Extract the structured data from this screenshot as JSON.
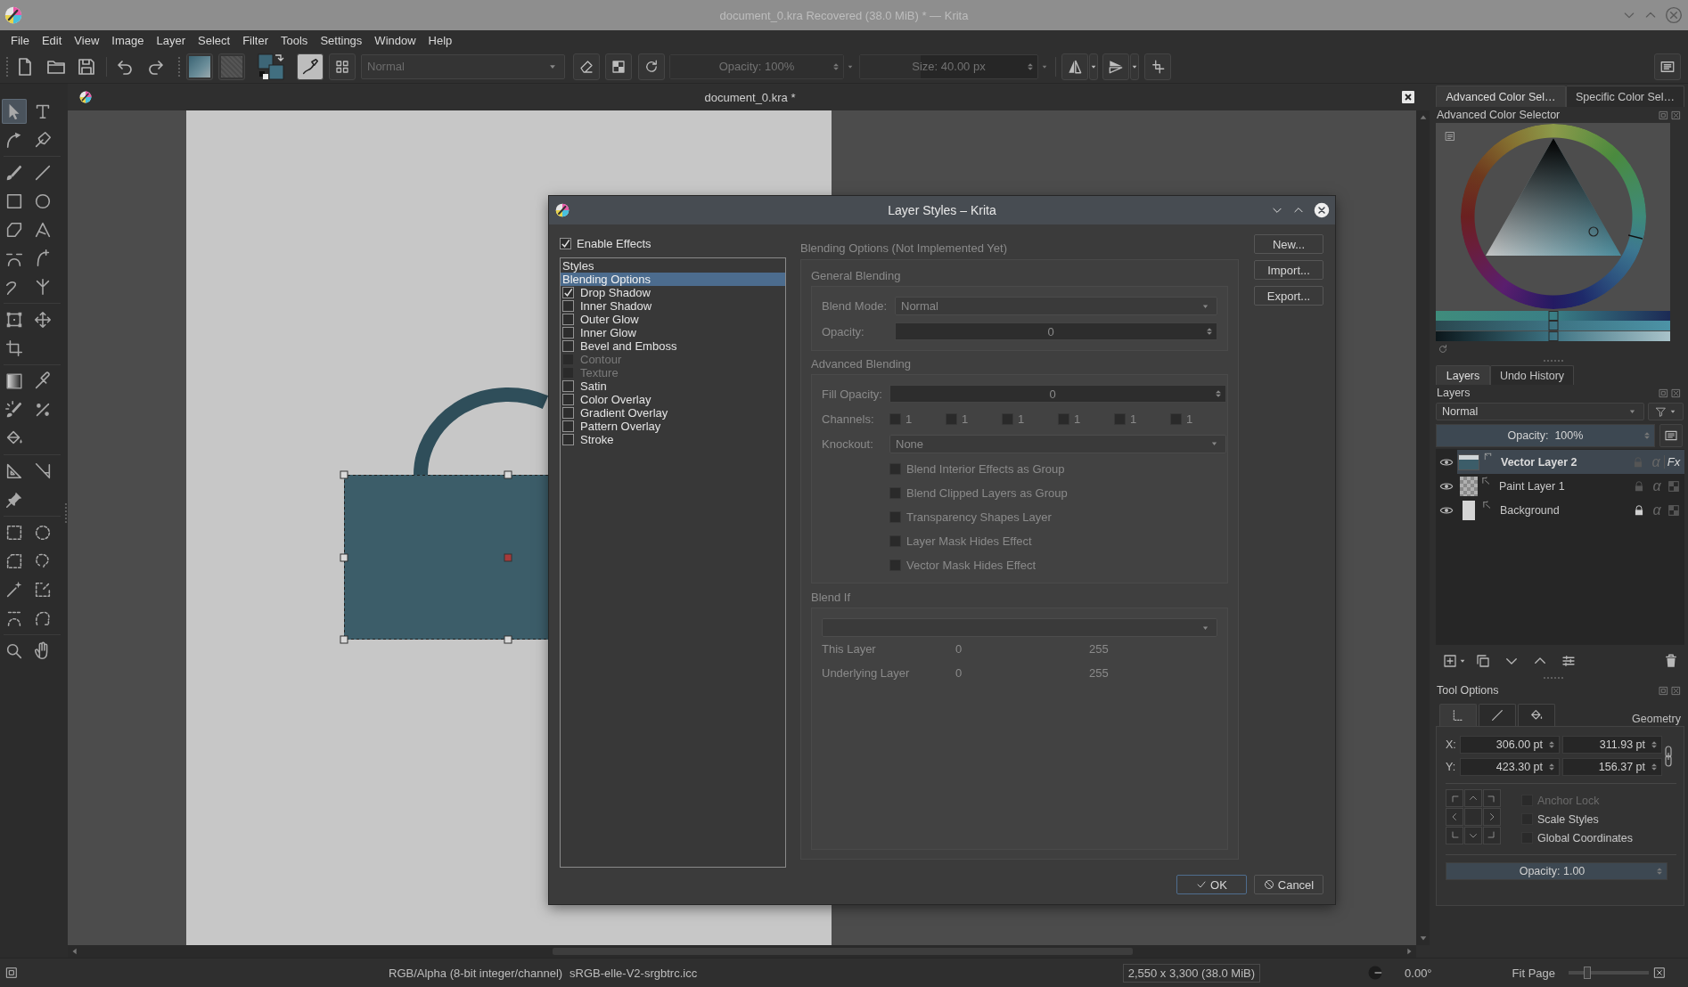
{
  "window": {
    "title": "document_0.kra Recovered (38.0 MiB) * — Krita"
  },
  "menu": [
    "File",
    "Edit",
    "View",
    "Image",
    "Layer",
    "Select",
    "Filter",
    "Tools",
    "Settings",
    "Window",
    "Help"
  ],
  "toolbar": {
    "blend_mode": {
      "value": "Normal",
      "disabled": true
    },
    "opacity": {
      "text": "Opacity: 100%",
      "level": 1,
      "disabled": true
    },
    "size": {
      "text": "Size: 40.00 px",
      "level": 0.34,
      "disabled": true
    }
  },
  "toolbox": {
    "groups": [
      [
        {
          "selected": true
        },
        {
          "selected": false
        },
        {
          "selected": false
        },
        {
          "selected": false
        }
      ],
      [
        {
          "selected": false
        },
        {
          "selected": false
        },
        {
          "selected": false
        },
        {
          "selected": false
        },
        {
          "selected": false
        },
        {
          "selected": false
        },
        {
          "selected": false
        },
        {
          "selected": false
        },
        {
          "selected": false
        },
        {
          "selected": false
        }
      ],
      [
        {
          "selected": false
        },
        {
          "selected": false
        },
        {
          "selected": false
        }
      ],
      [
        {
          "selected": false
        },
        {
          "selected": false
        },
        {
          "selected": false
        },
        {
          "selected": false
        },
        {
          "selected": false
        }
      ],
      [
        {
          "selected": false
        },
        {
          "selected": false
        },
        {
          "selected": false
        }
      ],
      [
        {
          "selected": false
        },
        {
          "selected": false
        },
        {
          "selected": false
        },
        {
          "selected": false
        },
        {
          "selected": false
        },
        {
          "selected": false
        },
        {
          "selected": false
        },
        {
          "selected": false
        }
      ],
      [
        {
          "selected": false
        },
        {
          "selected": false
        }
      ]
    ]
  },
  "document": {
    "tab_title": "document_0.kra *"
  },
  "dialog": {
    "title": "Layer Styles – Krita",
    "enable_effects": {
      "label": "Enable Effects",
      "checked": true
    },
    "styles": [
      {
        "label": "Styles",
        "kind": "plain",
        "selected": false
      },
      {
        "label": "Blending Options",
        "kind": "plain",
        "selected": true
      },
      {
        "label": "Drop Shadow",
        "kind": "checkbox",
        "selected": false,
        "checked": true,
        "disabled": false
      },
      {
        "label": "Inner Shadow",
        "kind": "checkbox",
        "selected": false,
        "checked": false,
        "disabled": false
      },
      {
        "label": "Outer Glow",
        "kind": "checkbox",
        "selected": false,
        "checked": false,
        "disabled": false
      },
      {
        "label": "Inner Glow",
        "kind": "checkbox",
        "selected": false,
        "checked": false,
        "disabled": false
      },
      {
        "label": "Bevel and Emboss",
        "kind": "checkbox",
        "selected": false,
        "checked": false,
        "disabled": false
      },
      {
        "label": "Contour",
        "kind": "checkbox",
        "selected": false,
        "checked": false,
        "disabled": true
      },
      {
        "label": "Texture",
        "kind": "checkbox",
        "selected": false,
        "checked": false,
        "disabled": true
      },
      {
        "label": "Satin",
        "kind": "checkbox",
        "selected": false,
        "checked": false,
        "disabled": false
      },
      {
        "label": "Color Overlay",
        "kind": "checkbox",
        "selected": false,
        "checked": false,
        "disabled": false
      },
      {
        "label": "Gradient Overlay",
        "kind": "checkbox",
        "selected": false,
        "checked": false,
        "disabled": false
      },
      {
        "label": "Pattern Overlay",
        "kind": "checkbox",
        "selected": false,
        "checked": false,
        "disabled": false
      },
      {
        "label": "Stroke",
        "kind": "checkbox",
        "selected": false,
        "checked": false,
        "disabled": false
      }
    ],
    "panel": {
      "title": "Blending Options (Not Implemented Yet)",
      "disabled": true,
      "general": {
        "title": "General Blending",
        "blend_mode_label": "Blend Mode:",
        "blend_mode": "Normal",
        "opacity_label": "Opacity:",
        "opacity": "0"
      },
      "advanced": {
        "title": "Advanced Blending",
        "fill_opacity_label": "Fill Opacity:",
        "fill_opacity": "0",
        "channels_label": "Channels:",
        "channels": [
          {
            "label": "1",
            "checked": false
          },
          {
            "label": "1",
            "checked": false
          },
          {
            "label": "1",
            "checked": false
          },
          {
            "label": "1",
            "checked": false
          },
          {
            "label": "1",
            "checked": false
          },
          {
            "label": "1",
            "checked": false
          }
        ],
        "knockout_label": "Knockout:",
        "knockout": "None",
        "options": [
          {
            "label": "Blend Interior Effects as Group",
            "checked": false
          },
          {
            "label": "Blend Clipped Layers as Group",
            "checked": false
          },
          {
            "label": "Transparency Shapes Layer",
            "checked": false
          },
          {
            "label": "Layer Mask Hides Effect",
            "checked": false
          },
          {
            "label": "Vector Mask Hides Effect",
            "checked": false
          }
        ]
      },
      "blend_if": {
        "title": "Blend If",
        "rows": [
          {
            "label": "This Layer",
            "min": "0",
            "max": "255"
          },
          {
            "label": "Underlying Layer",
            "min": "0",
            "max": "255"
          }
        ]
      }
    },
    "side_buttons": [
      "New...",
      "Import...",
      "Export..."
    ],
    "ok": "OK",
    "cancel": "Cancel"
  },
  "dock": {
    "color_tabs": [
      {
        "label": "Advanced Color Sel…",
        "selected": true
      },
      {
        "label": "Specific Color Sel…",
        "selected": false
      }
    ],
    "color_selector": {
      "title": "Advanced Color Selector",
      "sliders": [
        {
          "level": 0.5
        },
        {
          "level": 0.5
        },
        {
          "level": 0.5
        }
      ]
    },
    "layer_tabs": [
      {
        "label": "Layers",
        "selected": true
      },
      {
        "label": "Undo History",
        "selected": false
      }
    ],
    "layers": {
      "title": "Layers",
      "blend_mode": "Normal",
      "opacity": {
        "text": "Opacity:  100%",
        "level": 1
      },
      "items": [
        {
          "name": "Vector Layer 2",
          "kind": "vector",
          "selected": true,
          "visible": true,
          "locked": false,
          "alpha": "α",
          "effects": "Fx"
        },
        {
          "name": "Paint Layer 1",
          "kind": "paint",
          "selected": false,
          "visible": true,
          "locked": false,
          "alpha": "α"
        },
        {
          "name": "Background",
          "kind": "background",
          "selected": false,
          "visible": true,
          "locked": true,
          "alpha": "α"
        }
      ]
    },
    "tool_options": {
      "title": "Tool Options",
      "tabs": [
        {
          "selected": true
        },
        {
          "selected": false
        },
        {
          "selected": false
        }
      ],
      "section": "Geometry",
      "rows": [
        {
          "label": "X:",
          "values": [
            "306.00 pt",
            "311.93 pt"
          ]
        },
        {
          "label": "Y:",
          "values": [
            "423.30 pt",
            "156.37 pt"
          ]
        }
      ],
      "checks": [
        {
          "label": "Anchor Lock",
          "checked": false,
          "disabled": true
        },
        {
          "label": "Scale Styles",
          "checked": false,
          "disabled": false
        },
        {
          "label": "Global Coordinates",
          "checked": false,
          "disabled": false
        }
      ],
      "opacity": {
        "text": "Opacity: 1.00",
        "level": 1
      }
    }
  },
  "status_bar": {
    "color_space": "RGB/Alpha (8-bit integer/channel)",
    "profile": "sRGB-elle-V2-srgbtrc.icc",
    "image_size": "2,550 x 3,300 (38.0 MiB)",
    "rotation": "0.00°",
    "zoom": "Fit Page",
    "zoom_slider": {
      "level": 0.23
    }
  }
}
